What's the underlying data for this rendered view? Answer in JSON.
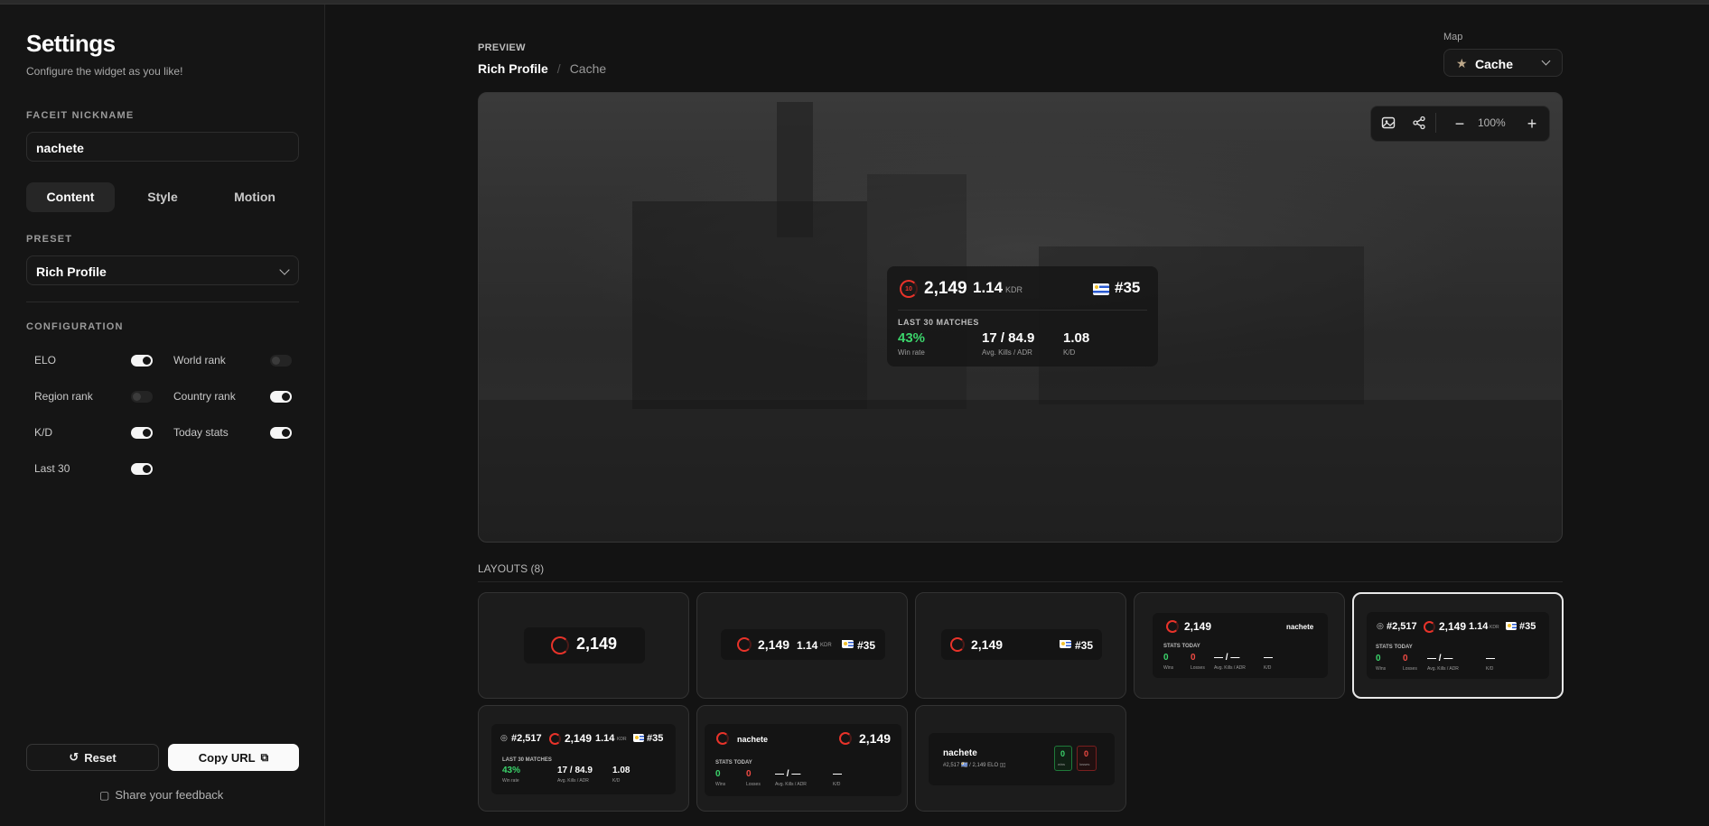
{
  "sidebar": {
    "title": "Settings",
    "subtitle": "Configure the widget as you like!",
    "nickname_label": "FACEIT NICKNAME",
    "nickname_value": "nachete",
    "tabs": [
      "Content",
      "Style",
      "Motion"
    ],
    "active_tab": "Content",
    "preset_label": "PRESET",
    "preset_value": "Rich Profile",
    "config_label": "CONFIGURATION",
    "toggles": [
      {
        "label": "ELO",
        "on": true
      },
      {
        "label": "World rank",
        "on": false
      },
      {
        "label": "Region rank",
        "on": false
      },
      {
        "label": "Country rank",
        "on": true
      },
      {
        "label": "K/D",
        "on": true
      },
      {
        "label": "Today stats",
        "on": true
      },
      {
        "label": "Last 30",
        "on": true
      }
    ],
    "reset_label": "Reset",
    "copy_label": "Copy URL",
    "feedback_label": "Share your feedback"
  },
  "header": {
    "preview_label": "PREVIEW",
    "crumb_preset": "Rich Profile",
    "crumb_map": "Cache",
    "map_label": "Map",
    "map_value": "Cache"
  },
  "toolbar": {
    "zoom": "100%",
    "icons": [
      "image-icon",
      "share-icon",
      "zoom-out-icon",
      "zoom-in-icon"
    ]
  },
  "widget": {
    "level": "10",
    "elo": "2,149",
    "kdr": "1.14",
    "kdr_label": "KDR",
    "country_rank": "#35",
    "section_label": "LAST 30 MATCHES",
    "win_rate": "43%",
    "win_rate_label": "Win rate",
    "kills_adr": "17 / 84.9",
    "kills_adr_label": "Avg. Kills / ADR",
    "kd": "1.08",
    "kd_label": "K/D"
  },
  "layouts": {
    "label": "LAYOUTS (8)",
    "nickname": "nachete",
    "world_rank": "#2,517",
    "elo": "2,149",
    "kdr": "1.14",
    "kdr_label": "KDR",
    "country_rank": "#35",
    "stats_today": "STATS TODAY",
    "last30": "LAST 30 MATCHES",
    "wins": "0",
    "wins_label": "Wins",
    "losses": "0",
    "losses_label": "Losses",
    "kills_adr_today": "— / —",
    "kills_adr_label": "Avg. Kills / ADR",
    "kd_today": "—",
    "kd_label": "K/D",
    "win_rate": "43%",
    "win_rate_label": "Win rate",
    "kills_adr": "17 / 84.9",
    "kd": "1.08",
    "mini_sub": "#2,517 🇺🇾 / 2,149 ELO ▯▯",
    "mini_wins_label": "wins",
    "mini_losses_label": "losses",
    "selected_index": 4
  },
  "colors": {
    "accent_red": "#e8332a",
    "win_green": "#3bd46b",
    "loss_red": "#ef4a43"
  }
}
